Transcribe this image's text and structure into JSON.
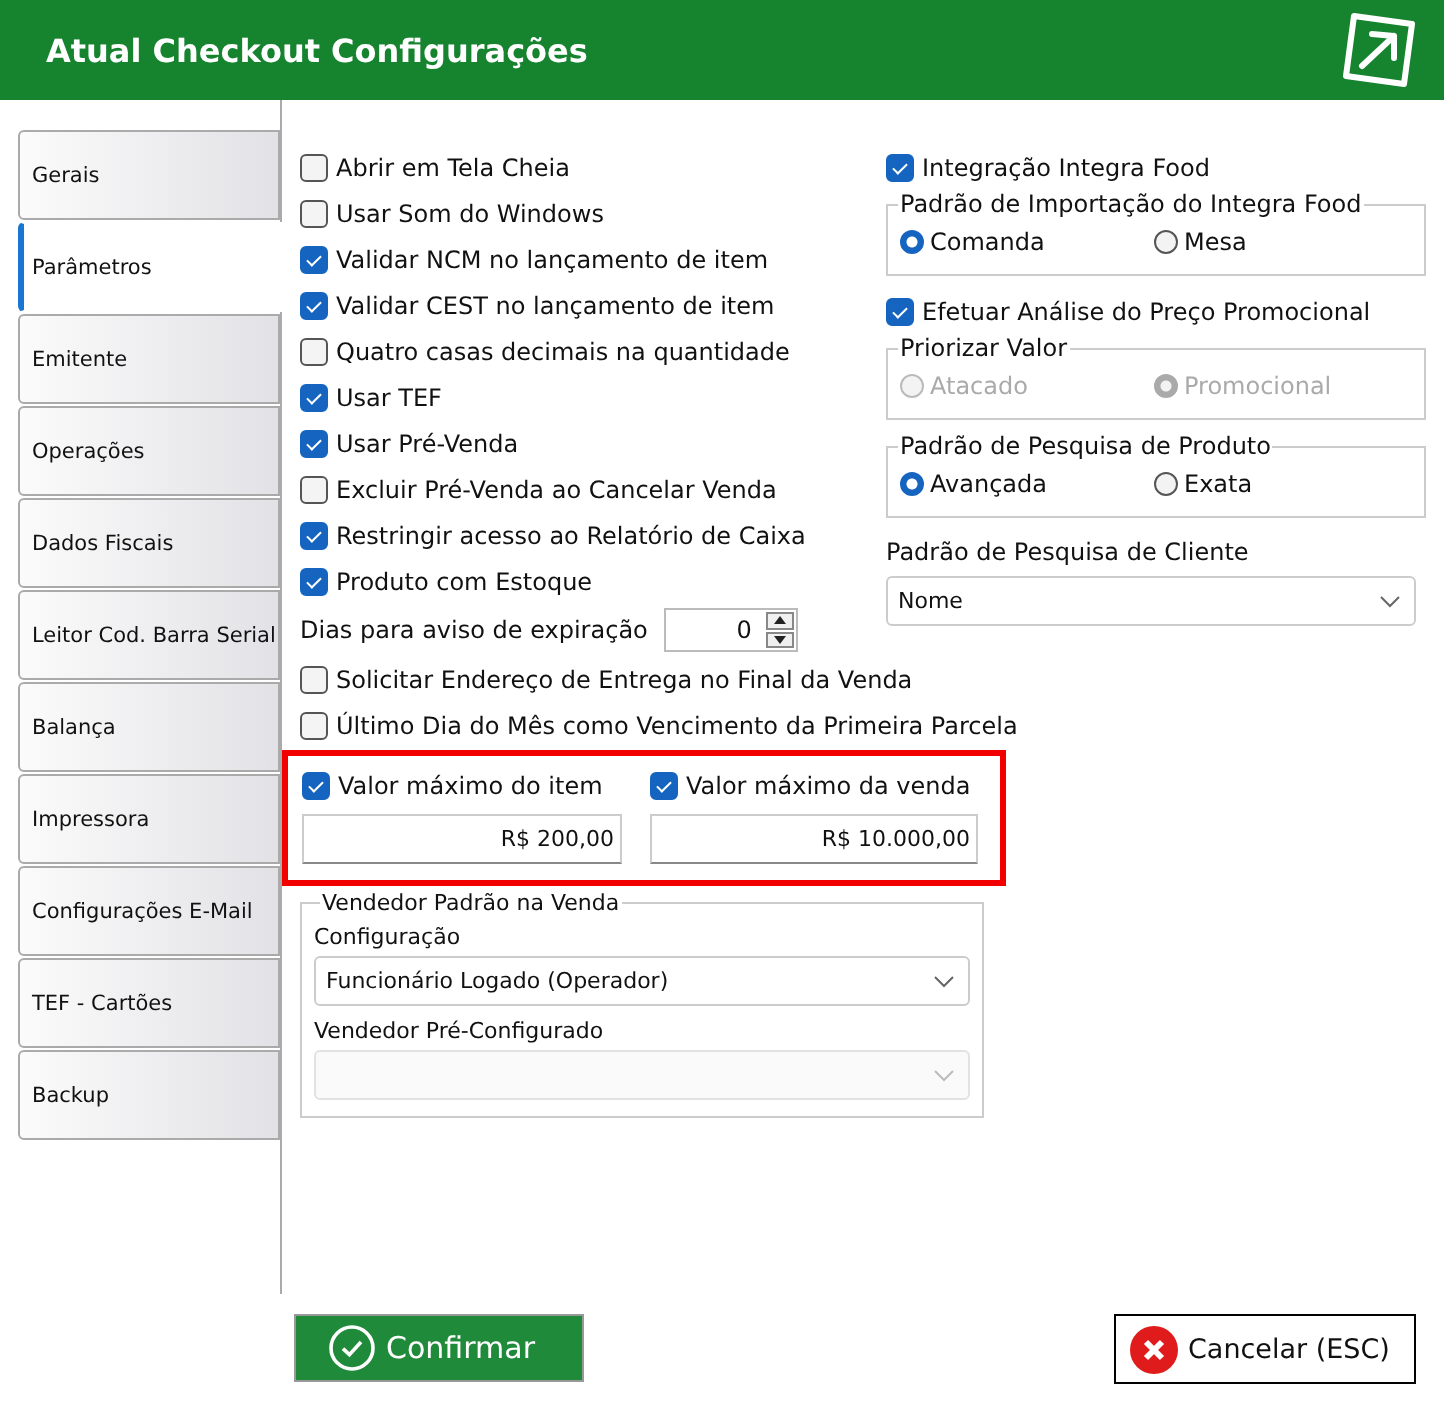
{
  "window": {
    "title": "Atual Checkout Configurações"
  },
  "tabs": [
    {
      "label": "Gerais",
      "selected": false
    },
    {
      "label": "Parâmetros",
      "selected": true
    },
    {
      "label": "Emitente",
      "selected": false
    },
    {
      "label": "Operações",
      "selected": false
    },
    {
      "label": "Dados Fiscais",
      "selected": false
    },
    {
      "label": "Leitor Cod. Barra Serial",
      "selected": false
    },
    {
      "label": "Balança",
      "selected": false
    },
    {
      "label": "Impressora",
      "selected": false
    },
    {
      "label": "Configurações E-Mail",
      "selected": false
    },
    {
      "label": "TEF - Cartões",
      "selected": false
    },
    {
      "label": "Backup",
      "selected": false
    }
  ],
  "left_options": [
    {
      "kind": "checkbox",
      "label": "Abrir em Tela Cheia",
      "checked": false
    },
    {
      "kind": "checkbox",
      "label": "Usar Som do Windows",
      "checked": false
    },
    {
      "kind": "checkbox",
      "label": "Validar NCM no lançamento de item",
      "checked": true
    },
    {
      "kind": "checkbox",
      "label": "Validar CEST no lançamento de item",
      "checked": true
    },
    {
      "kind": "checkbox",
      "label": "Quatro casas decimais na quantidade",
      "checked": false
    },
    {
      "kind": "checkbox",
      "label": "Usar TEF",
      "checked": true
    },
    {
      "kind": "checkbox",
      "label": "Usar Pré-Venda",
      "checked": true
    },
    {
      "kind": "checkbox",
      "label": "Excluir Pré-Venda ao Cancelar Venda",
      "checked": false
    },
    {
      "kind": "checkbox",
      "label": "Restringir acesso ao Relatório de Caixa",
      "checked": true
    },
    {
      "kind": "checkbox",
      "label": "Produto com Estoque",
      "checked": true
    },
    {
      "kind": "spinner",
      "label": "Dias para aviso de expiração",
      "value": "0"
    },
    {
      "kind": "checkbox",
      "label": "Solicitar Endereço de Entrega no Final da Venda",
      "checked": false
    },
    {
      "kind": "checkbox",
      "label": "Último Dia do Mês como Vencimento da Primeira Parcela",
      "checked": false
    }
  ],
  "limits": [
    {
      "label": "Valor máximo do item",
      "checked": true,
      "value": "R$ 200,00"
    },
    {
      "label": "Valor máximo da venda",
      "checked": true,
      "value": "R$ 10.000,00"
    }
  ],
  "seller_group": {
    "title": "Vendedor Padrão na Venda",
    "fields": [
      {
        "label": "Configuração",
        "value": "Funcionário Logado (Operador)",
        "disabled": false
      },
      {
        "label": "Vendedor Pré-Configurado",
        "disabled": true
      }
    ]
  },
  "right_options": [
    {
      "kind": "checkbox",
      "label": "Integração Integra Food",
      "checked": true
    },
    {
      "kind": "radio_group",
      "title": "Padrão de Importação do Integra Food",
      "disabled": false,
      "options": [
        {
          "label": "Comanda",
          "selected": true
        },
        {
          "label": "Mesa",
          "selected": false
        }
      ]
    },
    {
      "kind": "checkbox",
      "label": "Efetuar Análise do Preço Promocional",
      "checked": true
    },
    {
      "kind": "radio_group",
      "title": "Priorizar Valor",
      "disabled": true,
      "options": [
        {
          "label": "Atacado",
          "selected": false
        },
        {
          "label": "Promocional",
          "selected": true
        }
      ]
    },
    {
      "kind": "radio_group",
      "title": "Padrão de Pesquisa de Produto",
      "disabled": false,
      "options": [
        {
          "label": "Avançada",
          "selected": true
        },
        {
          "label": "Exata",
          "selected": false
        }
      ]
    },
    {
      "kind": "select",
      "label": "Padrão de Pesquisa de Cliente",
      "value": "Nome"
    }
  ],
  "buttons": [
    {
      "kind": "confirm",
      "label": "Confirmar"
    },
    {
      "kind": "cancel",
      "label": "Cancelar (ESC)"
    }
  ]
}
